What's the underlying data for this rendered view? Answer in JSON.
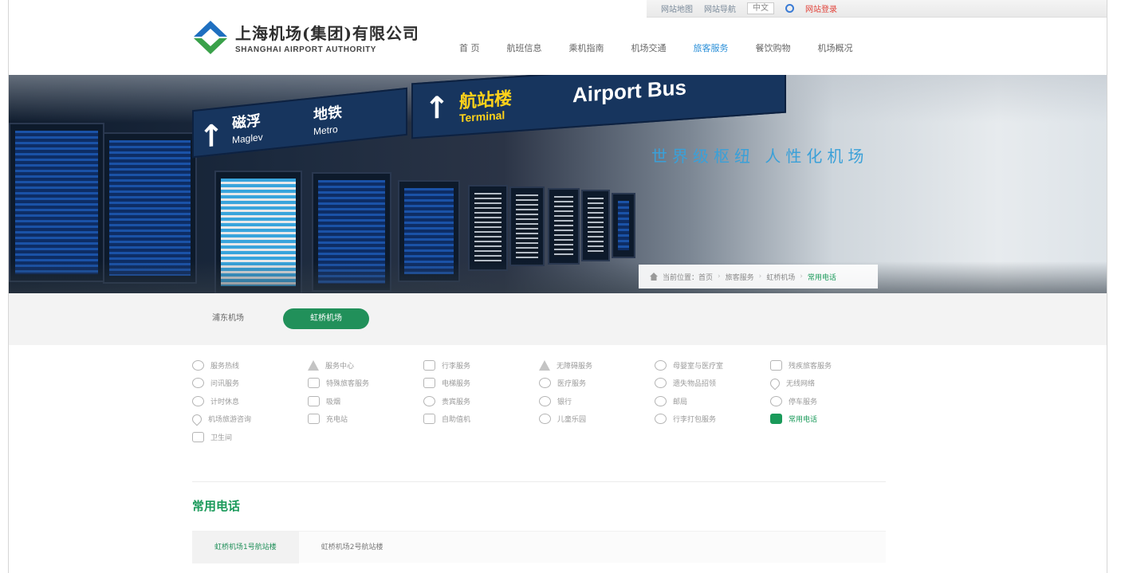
{
  "utility_bar": {
    "links": [
      "网站地图",
      "网站导航"
    ],
    "language": "中文",
    "login_label": "网站登录"
  },
  "header": {
    "logo_cn": "上海机场(集团)有限公司",
    "logo_en": "SHANGHAI AIRPORT AUTHORITY",
    "nav": [
      {
        "label": "首 页",
        "active": false
      },
      {
        "label": "航班信息",
        "active": false
      },
      {
        "label": "乘机指南",
        "active": false
      },
      {
        "label": "机场交通",
        "active": false
      },
      {
        "label": "旅客服务",
        "active": true
      },
      {
        "label": "餐饮购物",
        "active": false
      },
      {
        "label": "机场概况",
        "active": false
      }
    ]
  },
  "banner": {
    "slogan": "世界级枢纽 人性化机场",
    "signs": {
      "maglev_cn": "磁浮",
      "maglev_en": "Maglev",
      "metro_cn": "地铁",
      "metro_en": "Metro",
      "terminal_cn": "航站楼",
      "terminal_en": "Terminal",
      "bus_en": "Airport Bus"
    },
    "breadcrumb": [
      "当前位置：首页",
      "旅客服务",
      "虹桥机场",
      "常用电话"
    ]
  },
  "airport_tabs": [
    {
      "label": "浦东机场",
      "active": false
    },
    {
      "label": "虹桥机场",
      "active": true
    }
  ],
  "services": [
    [
      "服务热线",
      "服务中心",
      "行李服务",
      "无障碍服务",
      "母婴室与医疗室",
      "残疾旅客服务"
    ],
    [
      "问讯服务",
      "特殊旅客服务",
      "电梯服务",
      "医疗服务",
      "遗失物品招领",
      "无线网络"
    ],
    [
      "计时休息",
      "吸烟",
      "贵宾服务",
      "银行",
      "邮局",
      "停车服务"
    ],
    [
      "机场旅游咨询",
      "充电站",
      "自助值机",
      "儿童乐园",
      "行李打包服务",
      "常用电话"
    ],
    [
      "卫生间"
    ]
  ],
  "active_service": "常用电话",
  "section_title": "常用电话",
  "phone_tabs": [
    {
      "label": "虹桥机场1号航站楼",
      "active": true
    },
    {
      "label": "虹桥机场2号航站楼",
      "active": false
    }
  ],
  "colors": {
    "brand_green": "#21905a",
    "nav_active_blue": "#2a8fd8",
    "slogan_blue": "#3aa0d8"
  }
}
